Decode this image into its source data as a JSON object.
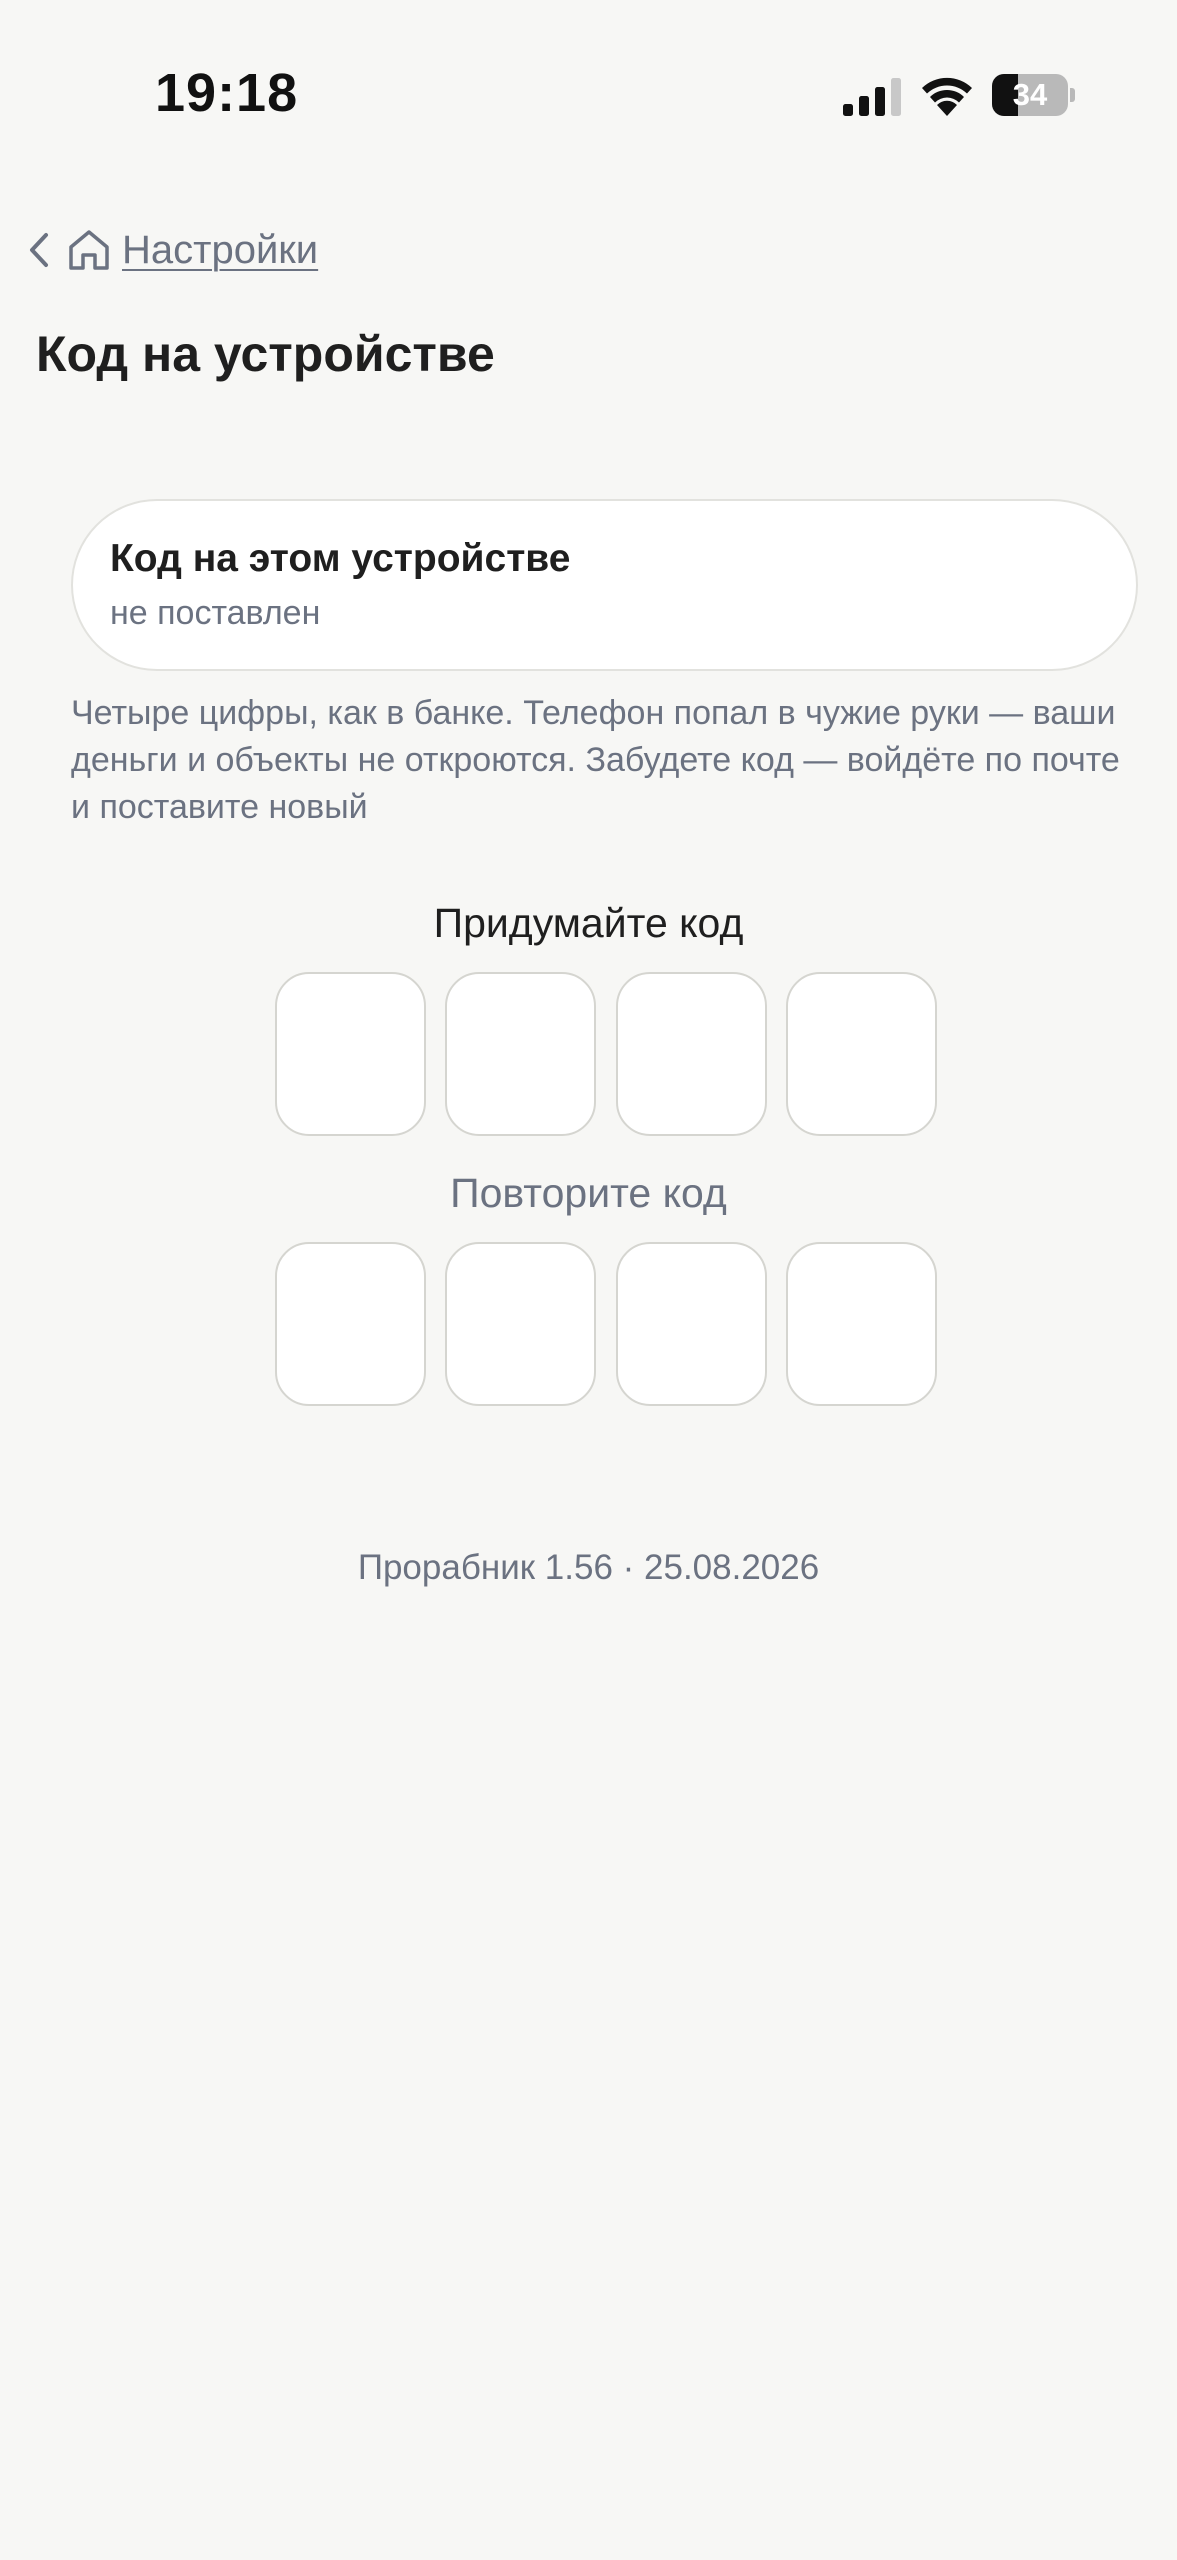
{
  "status_bar": {
    "time": "19:18",
    "battery_level": "34",
    "battery_fraction": 0.34,
    "icons": [
      "signal-icon",
      "wifi-icon",
      "battery-icon"
    ]
  },
  "breadcrumb": {
    "back_icon": "chevron-left-icon",
    "home_icon": "home-icon",
    "label": "Настройки"
  },
  "page": {
    "title": "Код на устройстве"
  },
  "card": {
    "title": "Код на этом устройстве",
    "subtitle": "не поставлен"
  },
  "description": "Четыре цифры, как в банке. Телефон попал в чужие руки — ваши деньги и объекты не откроются. Забудете код — войдёте по почте и поставите новый",
  "code_entry": {
    "create_label": "Придумайте код",
    "repeat_label": "Повторите код",
    "digits": [
      "",
      "",
      "",
      ""
    ],
    "repeat_digits": [
      "",
      "",
      "",
      ""
    ]
  },
  "footer": {
    "version": "Прорабник 1.56 · 25.08.2026"
  },
  "colors": {
    "background": "#f7f7f5",
    "text_primary": "#1f1f1f",
    "text_secondary": "#6b7281",
    "cell_border": "#d5d5d0"
  }
}
